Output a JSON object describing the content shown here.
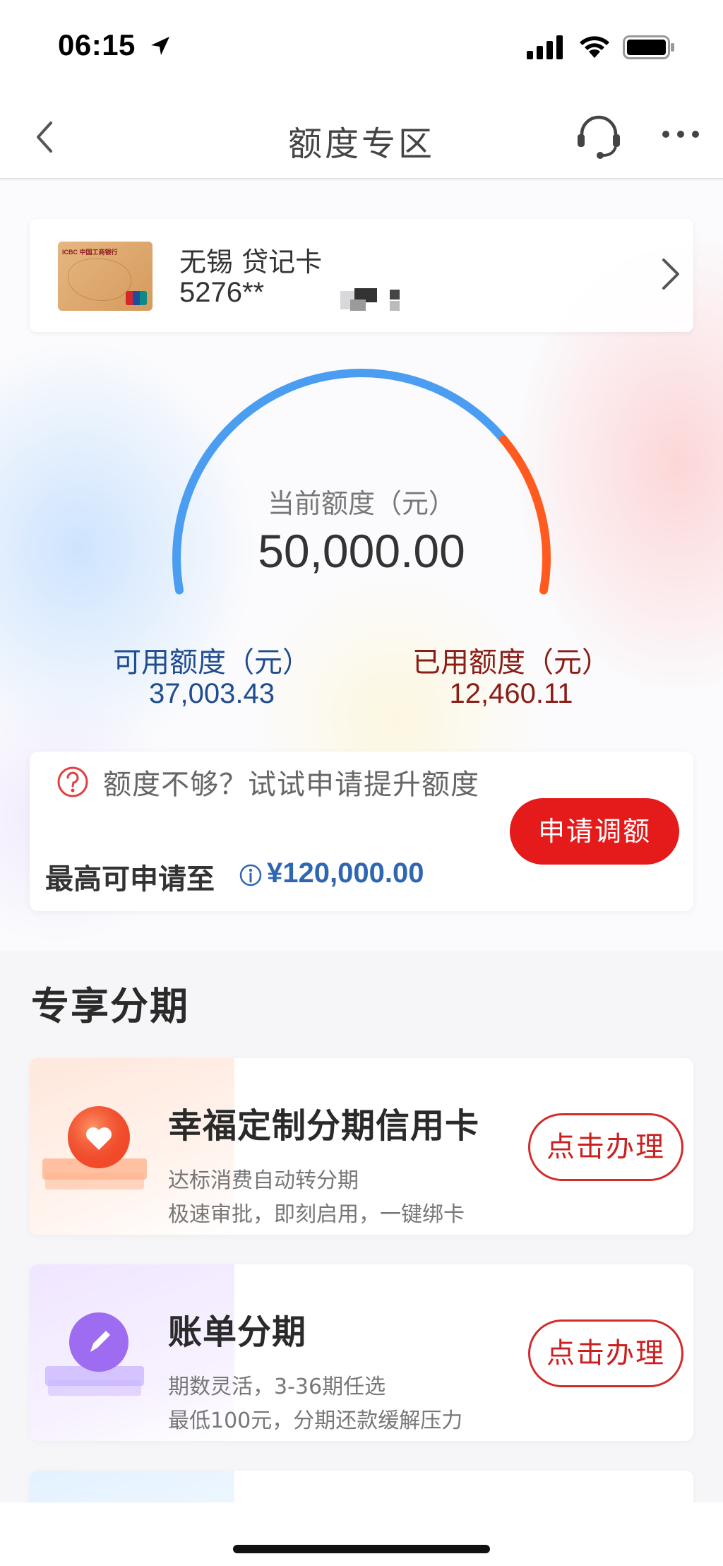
{
  "status_bar": {
    "time": "06:15"
  },
  "nav": {
    "title": "额度专区"
  },
  "card": {
    "name": "无锡 贷记卡",
    "number": "5276**"
  },
  "gauge": {
    "label": "当前额度（元）",
    "total": "50,000.00",
    "available_label": "可用额度（元）",
    "available_value": "37,003.43",
    "used_label": "已用额度（元）",
    "used_value": "12,460.11",
    "used_fraction": 0.2492
  },
  "boost": {
    "prompt": "额度不够？试试申请提升额度",
    "max_label": "最高可申请至",
    "max_value": "¥120,000.00",
    "button": "申请调额"
  },
  "section": {
    "title": "专享分期"
  },
  "offers": [
    {
      "title": "幸福定制分期信用卡",
      "line1": "达标消费自动转分期",
      "line2": "极速审批，即刻启用，一键绑卡",
      "button": "点击办理",
      "icon": "heart-icon"
    },
    {
      "title": "账单分期",
      "line1": "期数灵活，3-36期任选",
      "line2": "最低100元，分期还款缓解压力",
      "button": "点击办理",
      "icon": "pencil-icon"
    }
  ],
  "colors": {
    "accent_red": "#e51a1a",
    "available_blue": "#1f4d8f",
    "used_red": "#8b1c16",
    "gauge_blue": "#4a9df0",
    "gauge_orange": "#ff5a1f",
    "max_value_blue": "#2f66b3"
  }
}
